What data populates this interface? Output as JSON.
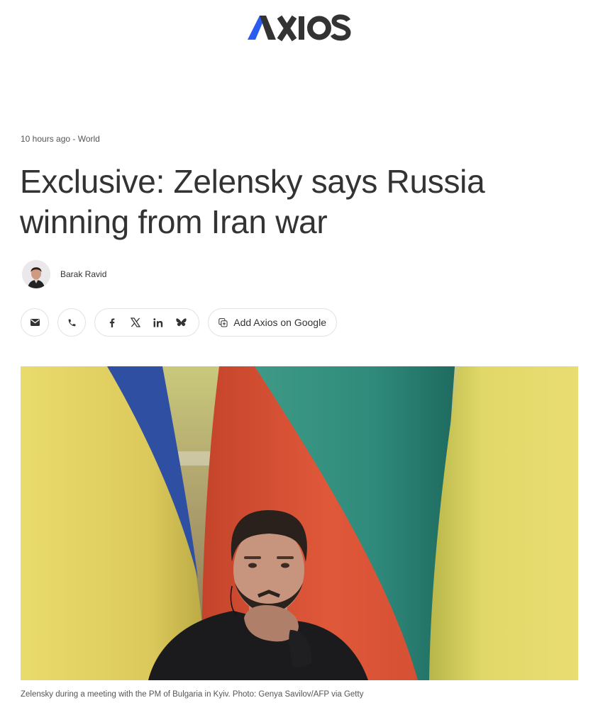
{
  "brand": {
    "name": "AXIOS",
    "accent_color": "#2a5cf0",
    "text_color": "#333333"
  },
  "article": {
    "timestamp": "10 hours ago",
    "separator": " - ",
    "section": "World",
    "headline": "Exclusive: Zelensky says Russia winning from Iran war",
    "author": "Barak Ravid"
  },
  "share": {
    "email_icon": "envelope-icon",
    "sms_icon": "phone-icon",
    "social_icons": [
      "facebook-icon",
      "x-icon",
      "linkedin-icon",
      "bluesky-icon"
    ],
    "google_label": "Add Axios on Google",
    "google_icon": "add-square-icon"
  },
  "image": {
    "caption": "Zelensky during a meeting with the PM of Bulgaria in Kyiv. Photo: Genya Savilov/AFP via Getty"
  }
}
